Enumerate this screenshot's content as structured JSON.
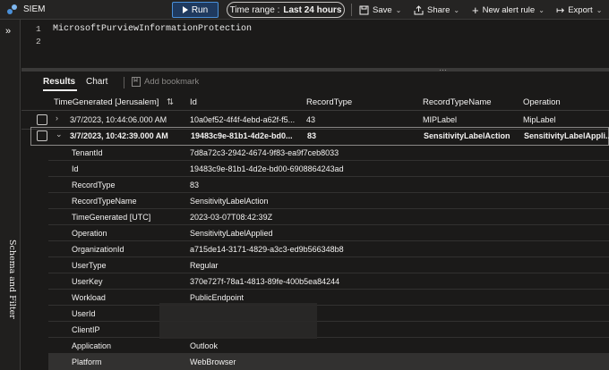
{
  "app": {
    "title": "SIEM"
  },
  "toolbar": {
    "run_label": "Run",
    "time_range_label": "Time range :",
    "time_range_value": "Last 24 hours",
    "save_label": "Save",
    "share_label": "Share",
    "new_alert_label": "New alert rule",
    "export_label": "Export"
  },
  "side_rail": {
    "label": "Schema and Filter"
  },
  "editor": {
    "line_numbers": [
      "1",
      "2"
    ],
    "query": "MicrosoftPurviewInformationProtection"
  },
  "results": {
    "tabs": [
      "Results",
      "Chart"
    ],
    "bookmark_label": "Add bookmark"
  },
  "table": {
    "columns": [
      "TimeGenerated [Jerusalem]",
      "Id",
      "RecordType",
      "RecordTypeName",
      "Operation"
    ],
    "rows": [
      {
        "time": "3/7/2023, 10:44:06.000 AM",
        "id": "10a0ef52-4f4f-4ebd-a62f-f5...",
        "record_type": "43",
        "record_type_name": "MIPLabel",
        "operation": "MipLabel"
      },
      {
        "time": "3/7/2023, 10:42:39.000 AM",
        "id": "19483c9e-81b1-4d2e-bd0...",
        "record_type": "83",
        "record_type_name": "SensitivityLabelAction",
        "operation": "SensitivityLabelAppli..."
      }
    ],
    "details": [
      {
        "key": "TenantId",
        "value": "7d8a72c3-2942-4674-9f83-ea9f7ceb8033"
      },
      {
        "key": "Id",
        "value": "19483c9e-81b1-4d2e-bd00-6908864243ad"
      },
      {
        "key": "RecordType",
        "value": "83"
      },
      {
        "key": "RecordTypeName",
        "value": "SensitivityLabelAction"
      },
      {
        "key": "TimeGenerated [UTC]",
        "value": "2023-03-07T08:42:39Z"
      },
      {
        "key": "Operation",
        "value": "SensitivityLabelApplied"
      },
      {
        "key": "OrganizationId",
        "value": "a715de14-3171-4829-a3c3-ed9b566348b8"
      },
      {
        "key": "UserType",
        "value": "Regular"
      },
      {
        "key": "UserKey",
        "value": "370e727f-78a1-4813-89fe-400b5ea84244"
      },
      {
        "key": "Workload",
        "value": "PublicEndpoint"
      },
      {
        "key": "UserId",
        "value": ""
      },
      {
        "key": "ClientIP",
        "value": ""
      },
      {
        "key": "Application",
        "value": "Outlook"
      },
      {
        "key": "Platform",
        "value": "WebBrowser"
      }
    ]
  },
  "colors": {
    "accent": "#4a90d9",
    "background": "#1b1a19",
    "toolbar": "#252423"
  }
}
